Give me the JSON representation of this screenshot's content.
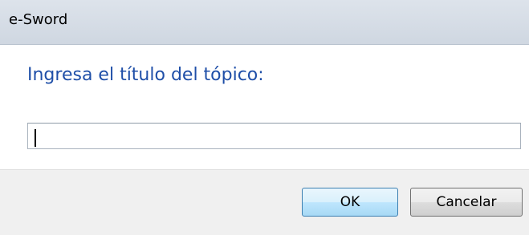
{
  "window": {
    "title": "e-Sword"
  },
  "dialog": {
    "prompt": "Ingresa el título del tópico:",
    "input_value": ""
  },
  "buttons": {
    "ok_label": "OK",
    "cancel_label": "Cancelar"
  },
  "colors": {
    "prompt_text": "#1f4fa8",
    "titlebar": "#d6dde6",
    "footer": "#f0f0f0",
    "ok_border": "#3c7fb1"
  }
}
